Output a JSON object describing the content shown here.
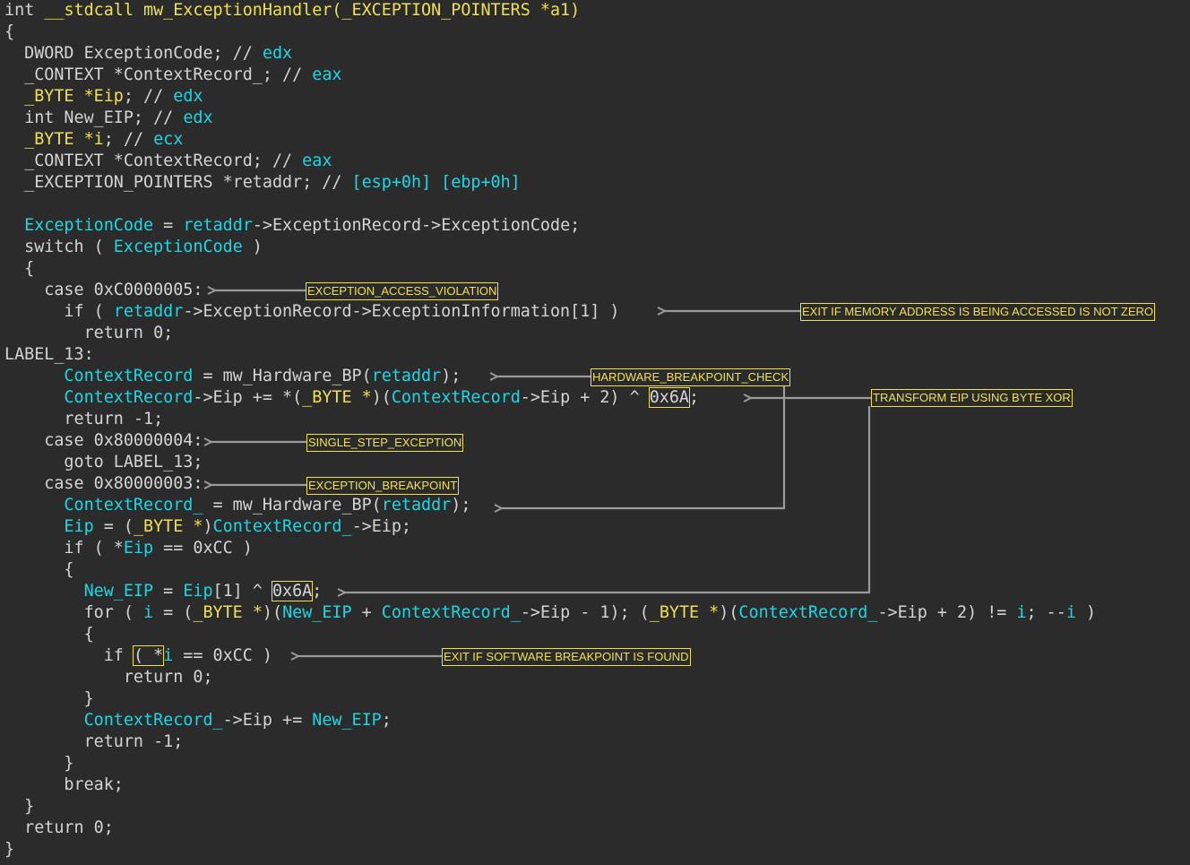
{
  "code_lines": [
    [
      [
        "t-type",
        "int "
      ],
      [
        "t-yellow",
        "__stdcall mw_ExceptionHandler(_EXCEPTION_POINTERS *a1)"
      ]
    ],
    [
      [
        "t-plain",
        "{"
      ]
    ],
    [
      [
        "t-plain",
        "  DWORD ExceptionCode; // "
      ],
      [
        "t-reg",
        "edx"
      ]
    ],
    [
      [
        "t-plain",
        "  _CONTEXT *ContextRecord_; // "
      ],
      [
        "t-reg",
        "eax"
      ]
    ],
    [
      [
        "t-yellow",
        "  _BYTE *Eip"
      ],
      [
        "t-plain",
        "; // "
      ],
      [
        "t-reg",
        "edx"
      ]
    ],
    [
      [
        "t-plain",
        "  int New_EIP; // "
      ],
      [
        "t-reg",
        "edx"
      ]
    ],
    [
      [
        "t-yellow",
        "  _BYTE *i"
      ],
      [
        "t-plain",
        "; // "
      ],
      [
        "t-reg",
        "ecx"
      ]
    ],
    [
      [
        "t-plain",
        "  _CONTEXT *ContextRecord; // "
      ],
      [
        "t-reg",
        "eax"
      ]
    ],
    [
      [
        "t-plain",
        "  _EXCEPTION_POINTERS *retaddr; // "
      ],
      [
        "t-reg",
        "[esp+0h] [ebp+0h]"
      ]
    ],
    [
      [
        "t-plain",
        ""
      ]
    ],
    [
      [
        "t-var",
        "  ExceptionCode"
      ],
      [
        "t-plain",
        " = "
      ],
      [
        "t-var",
        "retaddr"
      ],
      [
        "t-plain",
        "->ExceptionRecord->ExceptionCode;"
      ]
    ],
    [
      [
        "t-plain",
        "  switch ( "
      ],
      [
        "t-var",
        "ExceptionCode"
      ],
      [
        "t-plain",
        " )"
      ]
    ],
    [
      [
        "t-plain",
        "  {"
      ]
    ],
    [
      [
        "t-plain",
        "    case 0xC0000005:"
      ]
    ],
    [
      [
        "t-plain",
        "      if ( "
      ],
      [
        "t-var",
        "retaddr"
      ],
      [
        "t-plain",
        "->ExceptionRecord->ExceptionInformation[1] )"
      ]
    ],
    [
      [
        "t-plain",
        "        return 0;"
      ]
    ],
    [
      [
        "t-plain",
        "LABEL_13:"
      ]
    ],
    [
      [
        "t-var",
        "      ContextRecord"
      ],
      [
        "t-plain",
        " = mw_Hardware_BP("
      ],
      [
        "t-var",
        "retaddr"
      ],
      [
        "t-plain",
        ");"
      ]
    ],
    [
      [
        "t-var",
        "      ContextRecord"
      ],
      [
        "t-plain",
        "->Eip += *("
      ],
      [
        "t-yellow",
        "_BYTE *"
      ],
      [
        "t-plain",
        ")("
      ],
      [
        "t-var",
        "ContextRecord"
      ],
      [
        "t-plain",
        "->Eip + 2) ^ "
      ],
      [
        "t-hl",
        "0x6A"
      ],
      [
        "t-plain",
        ";"
      ]
    ],
    [
      [
        "t-plain",
        "      return -1;"
      ]
    ],
    [
      [
        "t-plain",
        "    case 0x80000004:"
      ]
    ],
    [
      [
        "t-plain",
        "      goto LABEL_13;"
      ]
    ],
    [
      [
        "t-plain",
        "    case 0x80000003:"
      ]
    ],
    [
      [
        "t-var",
        "      ContextRecord_"
      ],
      [
        "t-plain",
        " = mw_Hardware_BP("
      ],
      [
        "t-var",
        "retaddr"
      ],
      [
        "t-plain",
        ");"
      ]
    ],
    [
      [
        "t-var",
        "      Eip"
      ],
      [
        "t-plain",
        " = ("
      ],
      [
        "t-yellow",
        "_BYTE *"
      ],
      [
        "t-plain",
        ")"
      ],
      [
        "t-var",
        "ContextRecord_"
      ],
      [
        "t-plain",
        "->Eip;"
      ]
    ],
    [
      [
        "t-plain",
        "      if ( *"
      ],
      [
        "t-var",
        "Eip"
      ],
      [
        "t-plain",
        " == 0xCC )"
      ]
    ],
    [
      [
        "t-plain",
        "      {"
      ]
    ],
    [
      [
        "t-var",
        "        New_EIP"
      ],
      [
        "t-plain",
        " = "
      ],
      [
        "t-var",
        "Eip"
      ],
      [
        "t-plain",
        "[1] ^ "
      ],
      [
        "t-hl",
        "0x6A"
      ],
      [
        "t-plain",
        ";"
      ]
    ],
    [
      [
        "t-plain",
        "        for ( "
      ],
      [
        "t-var",
        "i"
      ],
      [
        "t-plain",
        " = ("
      ],
      [
        "t-yellow",
        "_BYTE *"
      ],
      [
        "t-plain",
        ")("
      ],
      [
        "t-var",
        "New_EIP"
      ],
      [
        "t-plain",
        " + "
      ],
      [
        "t-var",
        "ContextRecord_"
      ],
      [
        "t-plain",
        "->Eip - 1); ("
      ],
      [
        "t-yellow",
        "_BYTE *"
      ],
      [
        "t-plain",
        ")("
      ],
      [
        "t-var",
        "ContextRecord_"
      ],
      [
        "t-plain",
        "->Eip + 2) != "
      ],
      [
        "t-var",
        "i"
      ],
      [
        "t-plain",
        "; --"
      ],
      [
        "t-var",
        "i"
      ],
      [
        "t-plain",
        " )"
      ]
    ],
    [
      [
        "t-plain",
        "        {"
      ]
    ],
    [
      [
        "t-plain",
        "          if "
      ],
      [
        "t-hl",
        "( *"
      ],
      [
        "t-var",
        "i"
      ],
      [
        "t-plain",
        " == 0xCC )"
      ]
    ],
    [
      [
        "t-plain",
        "            return 0;"
      ]
    ],
    [
      [
        "t-plain",
        "        }"
      ]
    ],
    [
      [
        "t-var",
        "        ContextRecord_"
      ],
      [
        "t-plain",
        "->Eip += "
      ],
      [
        "t-var",
        "New_EIP"
      ],
      [
        "t-plain",
        ";"
      ]
    ],
    [
      [
        "t-plain",
        "        return -1;"
      ]
    ],
    [
      [
        "t-plain",
        "      }"
      ]
    ],
    [
      [
        "t-plain",
        "      break;"
      ]
    ],
    [
      [
        "t-plain",
        "  }"
      ]
    ],
    [
      [
        "t-plain",
        "  return 0;"
      ]
    ],
    [
      [
        "t-plain",
        "}"
      ]
    ]
  ],
  "annotations": {
    "access_violation": "EXCEPTION_ACCESS_VIOLATION",
    "exit_memory": "EXIT IF MEMORY ADDRESS IS BEING ACCESSED IS NOT ZERO",
    "hardware_bp": "HARDWARE_BREAKPOINT_CHECK",
    "transform_eip": "TRANSFORM EIP USING BYTE XOR",
    "single_step": "SINGLE_STEP_EXCEPTION",
    "breakpoint": "EXCEPTION_BREAKPOINT",
    "software_bp": "EXIT IF SOFTWARE BREAKPOINT IS FOUND"
  },
  "colors": {
    "background": "#2b2b2b",
    "text": "#d4d4d4",
    "variable": "#19d8e6",
    "highlight": "#f0e050",
    "arrow": "#9a9a9a"
  }
}
